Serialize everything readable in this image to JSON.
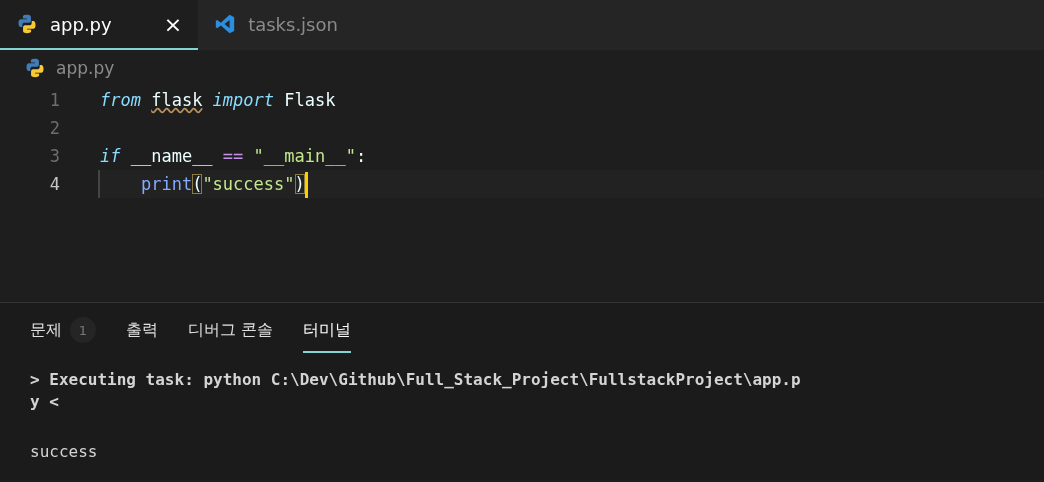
{
  "editor_tabs": [
    {
      "label": "app.py",
      "kind": "python",
      "selected": true,
      "close": "×"
    },
    {
      "label": "tasks.json",
      "kind": "vscode",
      "selected": false
    }
  ],
  "breadcrumb": {
    "kind": "python",
    "label": "app.py"
  },
  "code_lines": [
    {
      "number": "1",
      "current": false,
      "tokens": [
        {
          "kind": "keyword",
          "text": "from "
        },
        {
          "kind": "warning",
          "text": "flask"
        },
        {
          "kind": "keyword",
          "text": " import"
        },
        {
          "kind": "plain",
          "text": " Flask"
        }
      ]
    },
    {
      "number": "2",
      "current": false
    },
    {
      "number": "3",
      "current": false,
      "tokens": [
        {
          "kind": "keyword",
          "text": "if"
        },
        {
          "kind": "plain",
          "text": " __name__ "
        },
        {
          "kind": "operator",
          "text": "=="
        },
        {
          "kind": "string",
          "text": " \"__main__\""
        },
        {
          "kind": "plain",
          "text": ":"
        }
      ]
    },
    {
      "number": "4",
      "current": true,
      "cursor": true,
      "tokens": [
        {
          "kind": "function",
          "text": "    print"
        },
        {
          "kind": "bracket_match",
          "text": "("
        },
        {
          "kind": "string",
          "text": "\"success\""
        },
        {
          "kind": "bracket_match",
          "text": ")"
        }
      ]
    }
  ],
  "panel_tabs": [
    {
      "label": "문제",
      "badge": "1",
      "selected": false
    },
    {
      "label": "출력",
      "selected": false
    },
    {
      "label": "디버그 콘솔",
      "selected": false
    },
    {
      "label": "터미널",
      "selected": true
    }
  ],
  "terminal_lines": [
    {
      "kind": "command",
      "text": "> Executing task: python C:\\Dev\\Github\\Full_Stack_Project\\FullstackProject\\app.p"
    },
    {
      "kind": "command",
      "text": "y <"
    },
    {
      "kind": "output",
      "text": "success"
    }
  ]
}
